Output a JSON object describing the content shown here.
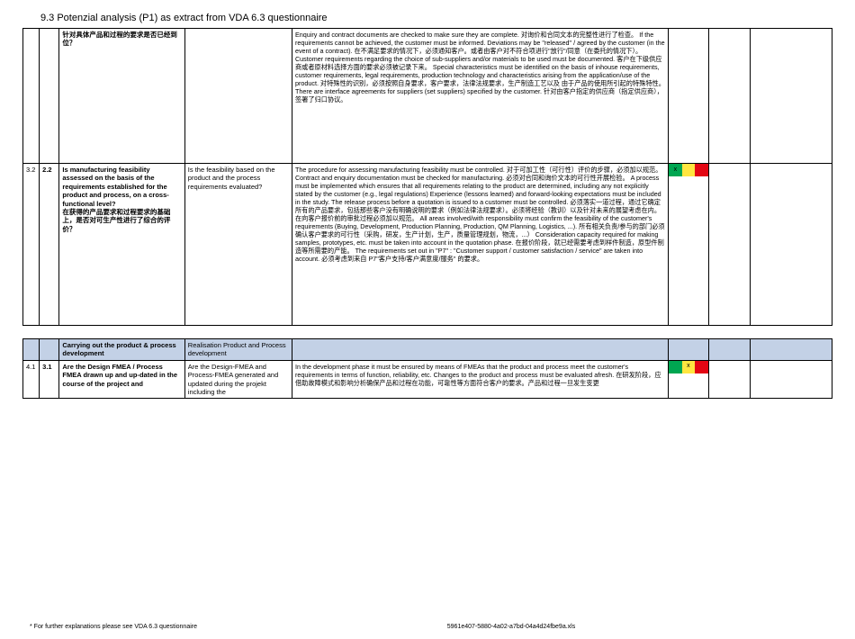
{
  "title": "9.3 Potenzial analysis (P1) as extract from VDA 6.3 questionnaire",
  "rows": {
    "r1": {
      "question": "针对具体产品和过程的要求是否已经到位？",
      "requirements": "Enquiry and contract documents are checked to make sure they are complete. 对询价和合同文本的完整性进行了检查。\nIf the requirements cannot be achieved, the customer must be informed. Deviations may be \"released\" / agreed by the customer (in the event of a contract). 在不满足要求的情况下，必须通知客户。或者由客户对不符合项进行\"放行\"/同意（在委托的情况下）。\nCustomer requirements regarding the choice of sub‑suppliers and/or materials to be used must be documented. 客户在下级供应商或者原材料选择方面的要求必须被记录下来。\nSpecial characteristics must be identified on the basis of inhouse requirements, customer requirements, legal requirements, production technology and characteristics arising from the application/use of the product. 对特殊性的识别，必须按照自身要求，客户要求，法律法规要求，生产制造工艺以及 由于产品的使用所引起的特殊特性。\nThere are interface agreements for suppliers (set suppliers) specified by the customer. 针对由客户指定的供应商（指定供应商），签署了归口协议。"
    },
    "r2": {
      "num1": "3.2",
      "num2": "2.2",
      "question_en": "Is manufacturing feasibility assessed on the basis of the requirements established for the product and process, on a cross-functional level?",
      "question_cn": "在获得的产品要求和过程要求的基础上，是否对可生产性进行了综合的评价？",
      "eval": "Is the feasibility based on the product and the process requirements evaluated?",
      "requirements": "The procedure for assessing manufacturing feasibility must be controlled. 对于可加工性（可行性）评价的步骤，必须加以规范。\nContract and enquiry documentation must be checked for manufacturing. 必须对合同和询价文本的可行性开展检验。\nA process must be implemented which ensures that all requirements relating to the product are determined, including any not explicitly stated by the customer (e.g., legal regulations) Experience (lessons learned) and forward‑looking expectations must be included in the study. The release process before a quotation is issued to a customer must be controlled. 必须落实一道过程，通过它确定所有的产品要求，包括那些客户没有明确说明的要求（例如法律法规要求）。必须将经验（教训）以及针对未来的展望考虑在内。在向客户报价前的审批过程必须加以规范。\nAll areas involved/with responsibility must confirm the feasibility of the customer's requirements (Buying, Development, Production Planning, Production, QM Planning, Logistics, ...).\n所有相关负责/参与的部门必须确认客户要求的可行性（采购，研发，生产计划，生产，质量管理规划，物流，...）\nConsideration capacity required for making samples, prototypes, etc. must be taken into account in the quotation phase.\n在报价阶段，就已经需要考虑到样件制造，原型件制造等所需要的产能。\nThe requirements set out in \"P7\" : \"Customer support / customer satisfaction / service\" are taken into account.  必须考虑到来自 P7\"客户支持/客户满意度/服务\" 的要求。",
      "status_mark": "x"
    },
    "header2": {
      "q": "Carrying out the product & process development",
      "eval": "Realisation Product and Process development"
    },
    "r3": {
      "num1": "4.1",
      "num2": "3.1",
      "question": "Are the Design FMEA / Process FMEA drawn up and up-dated in the course of the project and",
      "eval": "Are the Design-FMEA and Process-FMEA  generated and updated during the projekt including the",
      "requirements": "In the development phase it must be ensured by means of FMEAs that the product and process meet the customer's requirements in terms of function, reliability, etc. Changes to the product and process must be evaluated afresh. 在研发阶段，应借助故障模式和影响分析确保产品和过程在功能，可靠性等方面符合客户的要求。产品和过程一旦发生变更",
      "status_mark": "x"
    }
  },
  "footer_left": "* For further explanations please see  VDA 6.3 questionnaire",
  "footer_right": "5961e407-5880-4a02-a7bd-04a4d24fbe9a.xls"
}
